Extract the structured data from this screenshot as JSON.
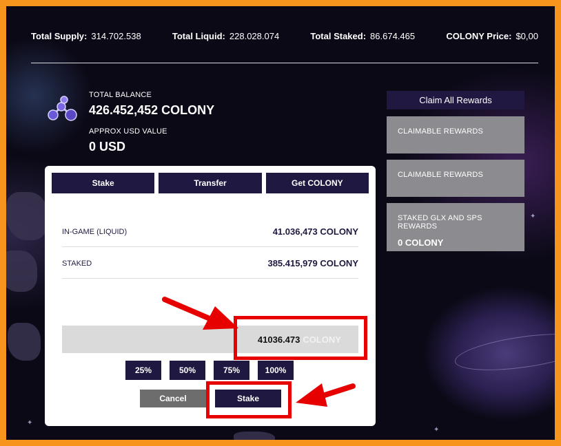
{
  "stats": [
    {
      "label": "Total Supply:",
      "value": "314.702.538"
    },
    {
      "label": "Total Liquid:",
      "value": "228.028.074"
    },
    {
      "label": "Total Staked:",
      "value": "86.674.465"
    },
    {
      "label": "COLONY Price:",
      "value": "$0,00"
    }
  ],
  "balance": {
    "total_label": "TOTAL BALANCE",
    "total_value": "426.452,452 COLONY",
    "usd_label": "APPROX USD VALUE",
    "usd_value": "0 USD",
    "icon": "colony-token-icon"
  },
  "rewards": {
    "claim_all_label": "Claim All Rewards",
    "cards": [
      {
        "title": "CLAIMABLE REWARDS",
        "value": ""
      },
      {
        "title": "CLAIMABLE REWARDS",
        "value": ""
      },
      {
        "title": "STAKED GLX AND SPS REWARDS",
        "value": "0 COLONY"
      }
    ]
  },
  "panel": {
    "tabs": [
      "Stake",
      "Transfer",
      "Get COLONY"
    ],
    "rows": [
      {
        "label": "IN-GAME (LIQUID)",
        "value": "41.036,473 COLONY"
      },
      {
        "label": "STAKED",
        "value": "385.415,979 COLONY"
      }
    ],
    "amount_value": "41036.473",
    "amount_unit": "COLONY",
    "percent_buttons": [
      "25%",
      "50%",
      "75%",
      "100%"
    ],
    "cancel_label": "Cancel",
    "stake_label": "Stake"
  },
  "colors": {
    "border": "#f7941d",
    "navy": "#1f1840",
    "highlight": "#e60000",
    "card_gray": "#8b8b90"
  }
}
